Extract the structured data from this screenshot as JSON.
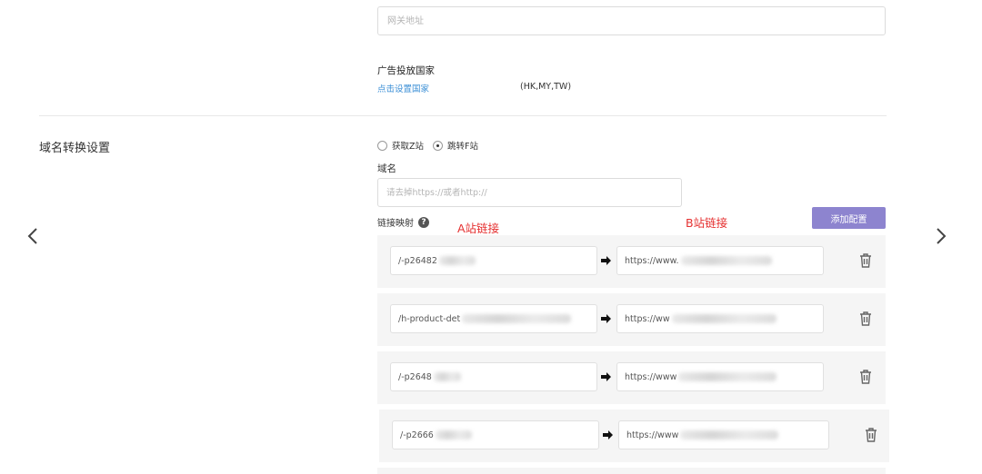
{
  "gateway": {
    "placeholder": "网关地址"
  },
  "ad_country": {
    "label": "广告投放国家",
    "link": "点击设置国家",
    "value": "(HK,MY,TW)"
  },
  "domain_section": {
    "title": "域名转换设置",
    "radio_options": [
      {
        "label": "获取Z站",
        "checked": false
      },
      {
        "label": "跳转F站",
        "checked": true
      }
    ],
    "domain_label": "域名",
    "domain_placeholder": "请去掉https://或者http://",
    "mapping_label": "链接映射",
    "annotation_a": "A站链接",
    "annotation_b": "B站链接",
    "add_button": "添加配置"
  },
  "mappings": [
    {
      "from": "/-p26482",
      "to": "https://www."
    },
    {
      "from": "/h-product-det",
      "to": "https://ww"
    },
    {
      "from": "/-p2648",
      "to": "https://www"
    },
    {
      "from": "/-p2666",
      "to": "https://www"
    }
  ],
  "icons": {
    "nav_left": "chevron-left-icon",
    "nav_right": "chevron-right-icon",
    "help": "question-circle-icon",
    "arrow": "arrow-right-icon",
    "delete": "trash-icon"
  },
  "colors": {
    "button": "#8d84cf",
    "link": "#3b8fd6",
    "annotation": "#e53030",
    "row_bg": "#f5f5f5"
  }
}
